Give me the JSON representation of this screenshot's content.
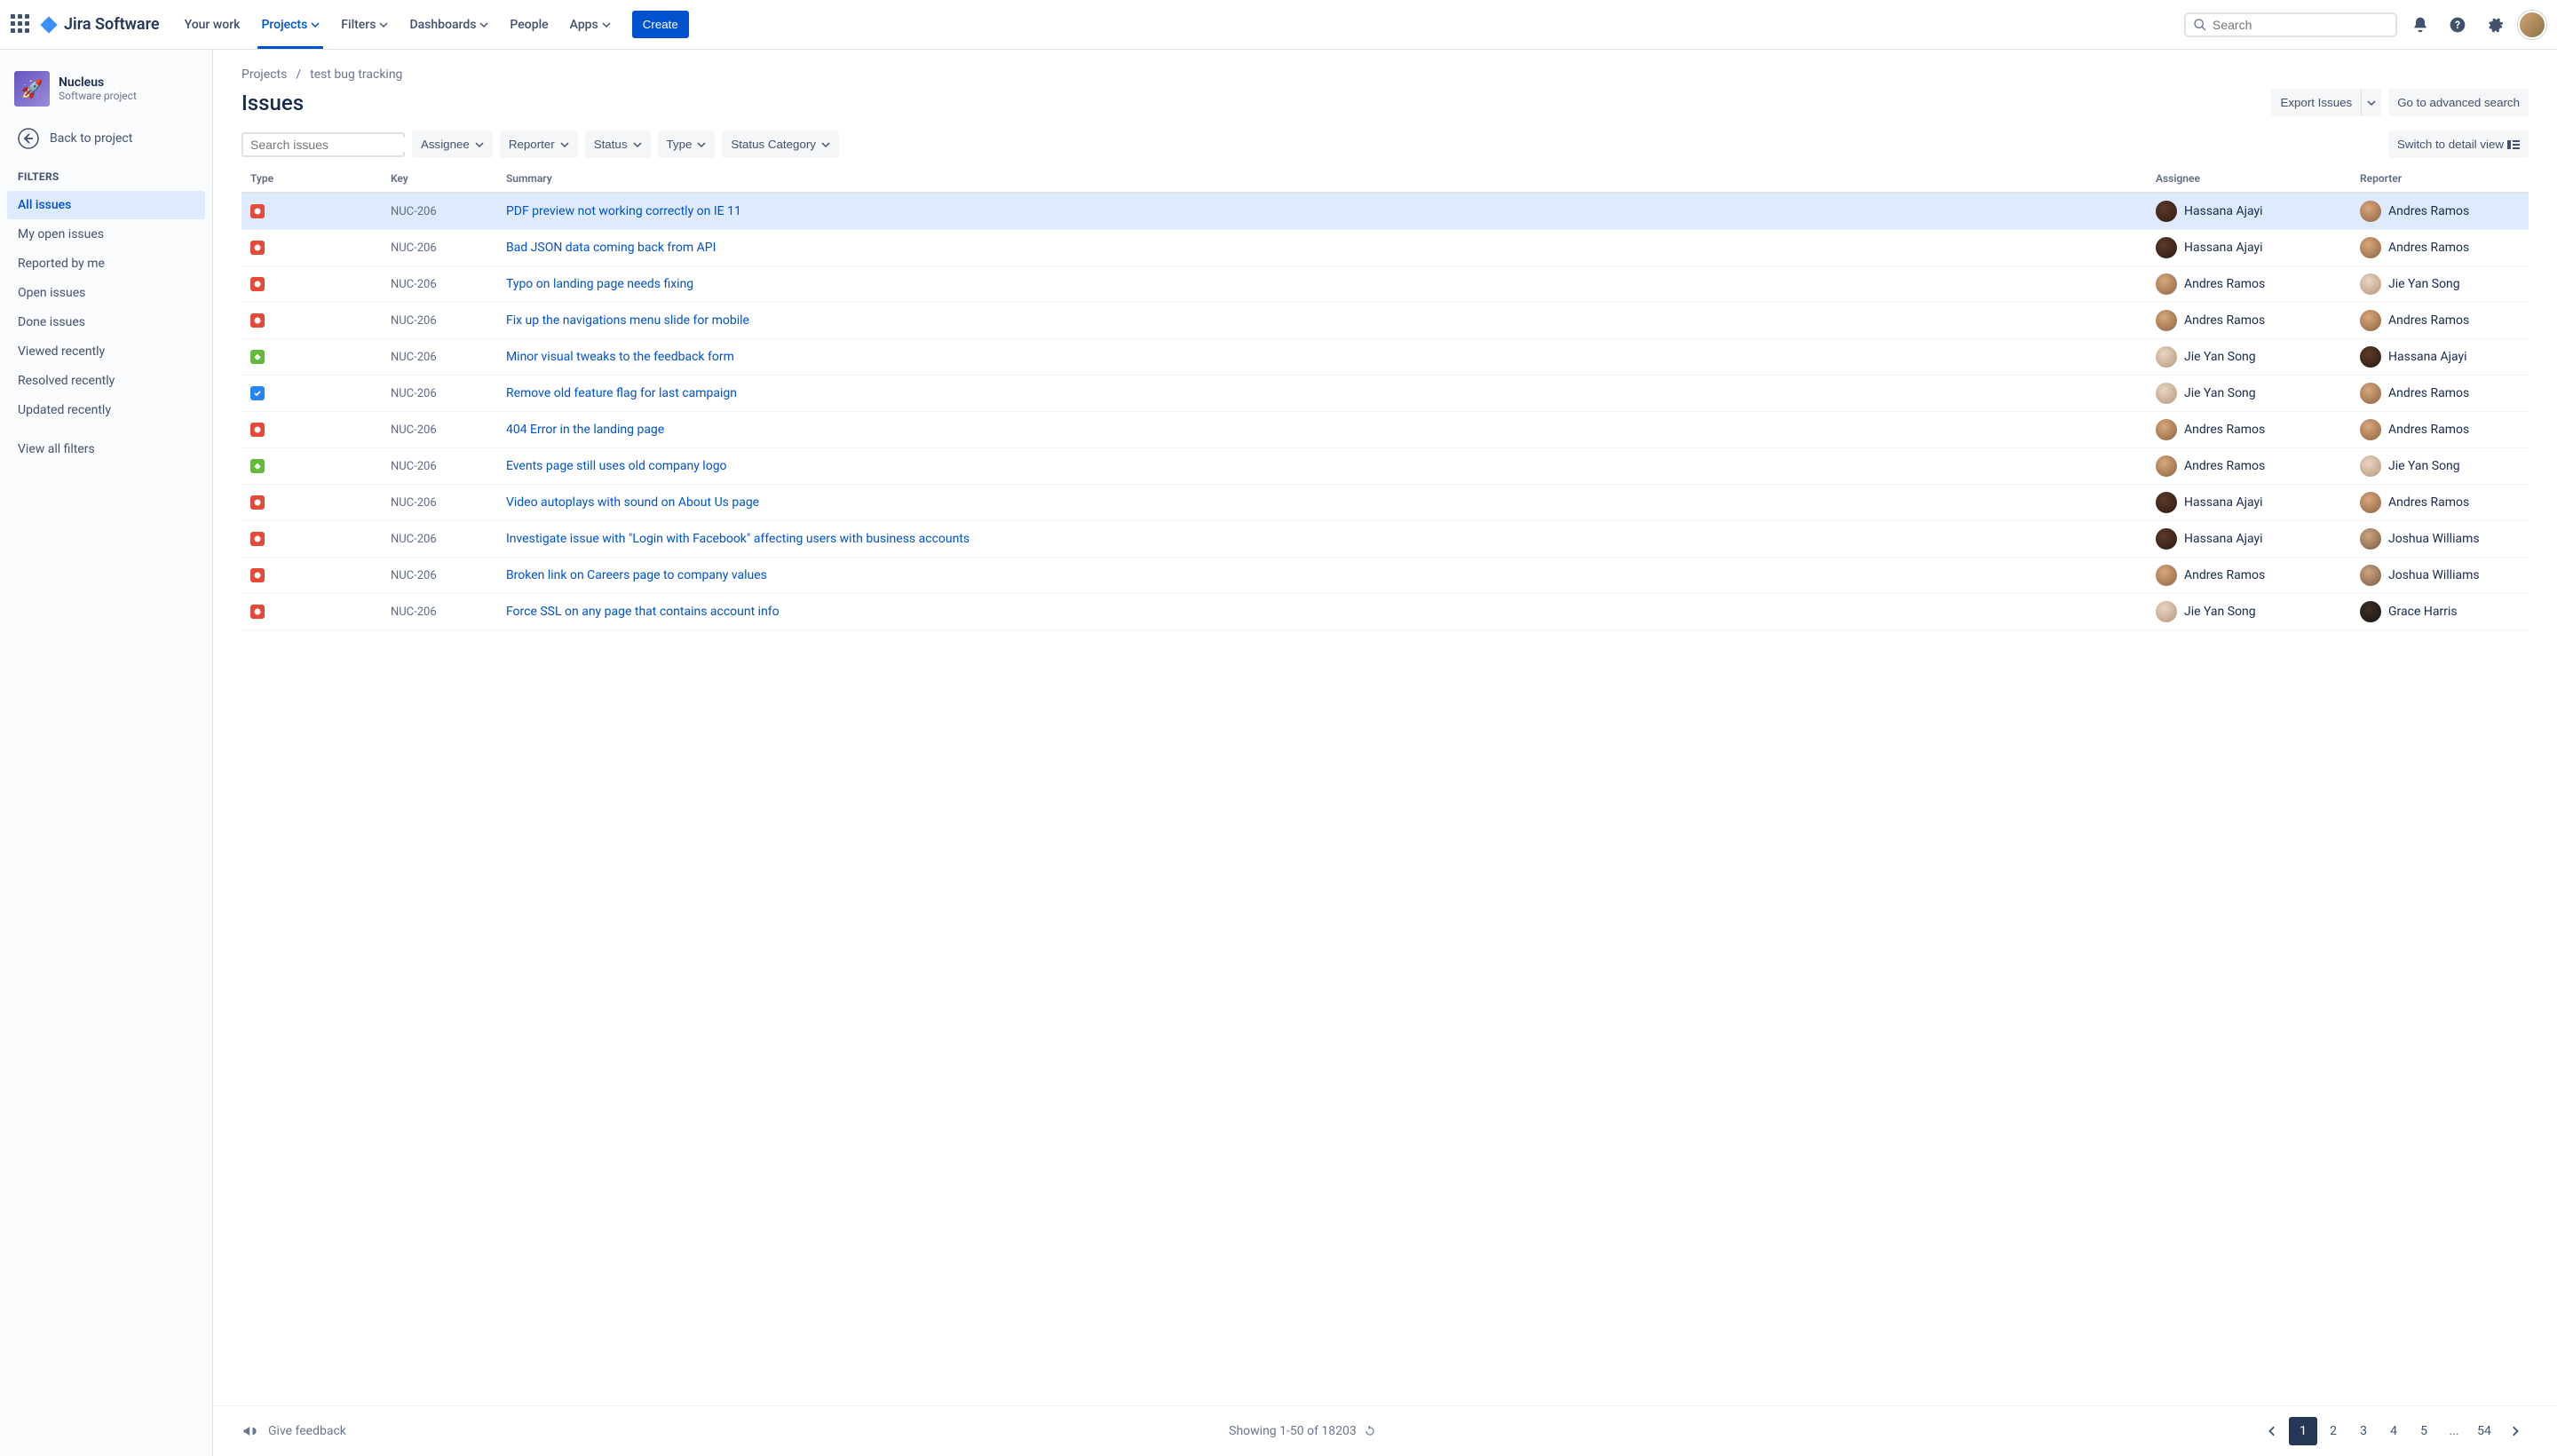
{
  "nav": {
    "logo_text": "Jira Software",
    "items": [
      {
        "label": "Your work",
        "dropdown": false
      },
      {
        "label": "Projects",
        "dropdown": true,
        "active": true
      },
      {
        "label": "Filters",
        "dropdown": true
      },
      {
        "label": "Dashboards",
        "dropdown": true
      },
      {
        "label": "People",
        "dropdown": false
      },
      {
        "label": "Apps",
        "dropdown": true
      }
    ],
    "create": "Create",
    "search_placeholder": "Search"
  },
  "sidebar": {
    "project_name": "Nucleus",
    "project_type": "Software project",
    "back": "Back to project",
    "filters_heading": "Filters",
    "filters": [
      {
        "label": "All issues",
        "active": true
      },
      {
        "label": "My open issues"
      },
      {
        "label": "Reported by me"
      },
      {
        "label": "Open issues"
      },
      {
        "label": "Done issues"
      },
      {
        "label": "Viewed recently"
      },
      {
        "label": "Resolved recently"
      },
      {
        "label": "Updated recently"
      }
    ],
    "view_all": "View all filters"
  },
  "breadcrumb": {
    "projects": "Projects",
    "project": "test bug tracking"
  },
  "page_title": "Issues",
  "header_actions": {
    "export": "Export Issues",
    "advanced": "Go to advanced search"
  },
  "filter_bar": {
    "search_placeholder": "Search issues",
    "assignee": "Assignee",
    "reporter": "Reporter",
    "status": "Status",
    "type": "Type",
    "status_category": "Status Category",
    "switch_view": "Switch to detail view"
  },
  "columns": {
    "type": "Type",
    "key": "Key",
    "summary": "Summary",
    "assignee": "Assignee",
    "reporter": "Reporter"
  },
  "issues": [
    {
      "type": "bug",
      "key": "NUC-206",
      "summary": "PDF preview not working correctly on IE 11",
      "assignee": "Hassana Ajayi",
      "reporter": "Andres Ramos",
      "a_av": "hassana",
      "r_av": "andres",
      "selected": true
    },
    {
      "type": "bug",
      "key": "NUC-206",
      "summary": "Bad JSON data coming back from API",
      "assignee": "Hassana Ajayi",
      "reporter": "Andres Ramos",
      "a_av": "hassana",
      "r_av": "andres"
    },
    {
      "type": "bug",
      "key": "NUC-206",
      "summary": "Typo on landing page needs fixing",
      "assignee": "Andres Ramos",
      "reporter": "Jie Yan Song",
      "a_av": "andres",
      "r_av": "jie"
    },
    {
      "type": "bug",
      "key": "NUC-206",
      "summary": "Fix up the navigations menu slide for mobile",
      "assignee": "Andres Ramos",
      "reporter": "Andres Ramos",
      "a_av": "andres",
      "r_av": "andres"
    },
    {
      "type": "story",
      "key": "NUC-206",
      "summary": "Minor visual tweaks to the feedback form",
      "assignee": "Jie Yan Song",
      "reporter": "Hassana Ajayi",
      "a_av": "jie",
      "r_av": "hassana"
    },
    {
      "type": "task",
      "key": "NUC-206",
      "summary": "Remove old feature flag for last campaign",
      "assignee": "Jie Yan Song",
      "reporter": "Andres Ramos",
      "a_av": "jie",
      "r_av": "andres"
    },
    {
      "type": "bug",
      "key": "NUC-206",
      "summary": "404 Error in the landing page",
      "assignee": "Andres Ramos",
      "reporter": "Andres Ramos",
      "a_av": "andres",
      "r_av": "andres"
    },
    {
      "type": "story",
      "key": "NUC-206",
      "summary": "Events page still uses old company logo",
      "assignee": "Andres Ramos",
      "reporter": "Jie Yan Song",
      "a_av": "andres",
      "r_av": "jie"
    },
    {
      "type": "bug",
      "key": "NUC-206",
      "summary": "Video autoplays with sound on About Us page",
      "assignee": "Hassana Ajayi",
      "reporter": "Andres Ramos",
      "a_av": "hassana",
      "r_av": "andres"
    },
    {
      "type": "bug",
      "key": "NUC-206",
      "summary": "Investigate issue with \"Login with Facebook\" affecting users with business accounts",
      "assignee": "Hassana Ajayi",
      "reporter": "Joshua Williams",
      "a_av": "hassana",
      "r_av": "joshua"
    },
    {
      "type": "bug",
      "key": "NUC-206",
      "summary": "Broken link on Careers page to company values",
      "assignee": "Andres Ramos",
      "reporter": "Joshua Williams",
      "a_av": "andres",
      "r_av": "joshua"
    },
    {
      "type": "bug",
      "key": "NUC-206",
      "summary": "Force SSL on any page that contains account info",
      "assignee": "Jie Yan Song",
      "reporter": "Grace Harris",
      "a_av": "jie",
      "r_av": "grace"
    }
  ],
  "footer": {
    "feedback": "Give feedback",
    "showing": "Showing 1-50 of 18203"
  },
  "pagination": {
    "pages": [
      "1",
      "2",
      "3",
      "4",
      "5",
      "...",
      "54"
    ],
    "active": "1"
  }
}
